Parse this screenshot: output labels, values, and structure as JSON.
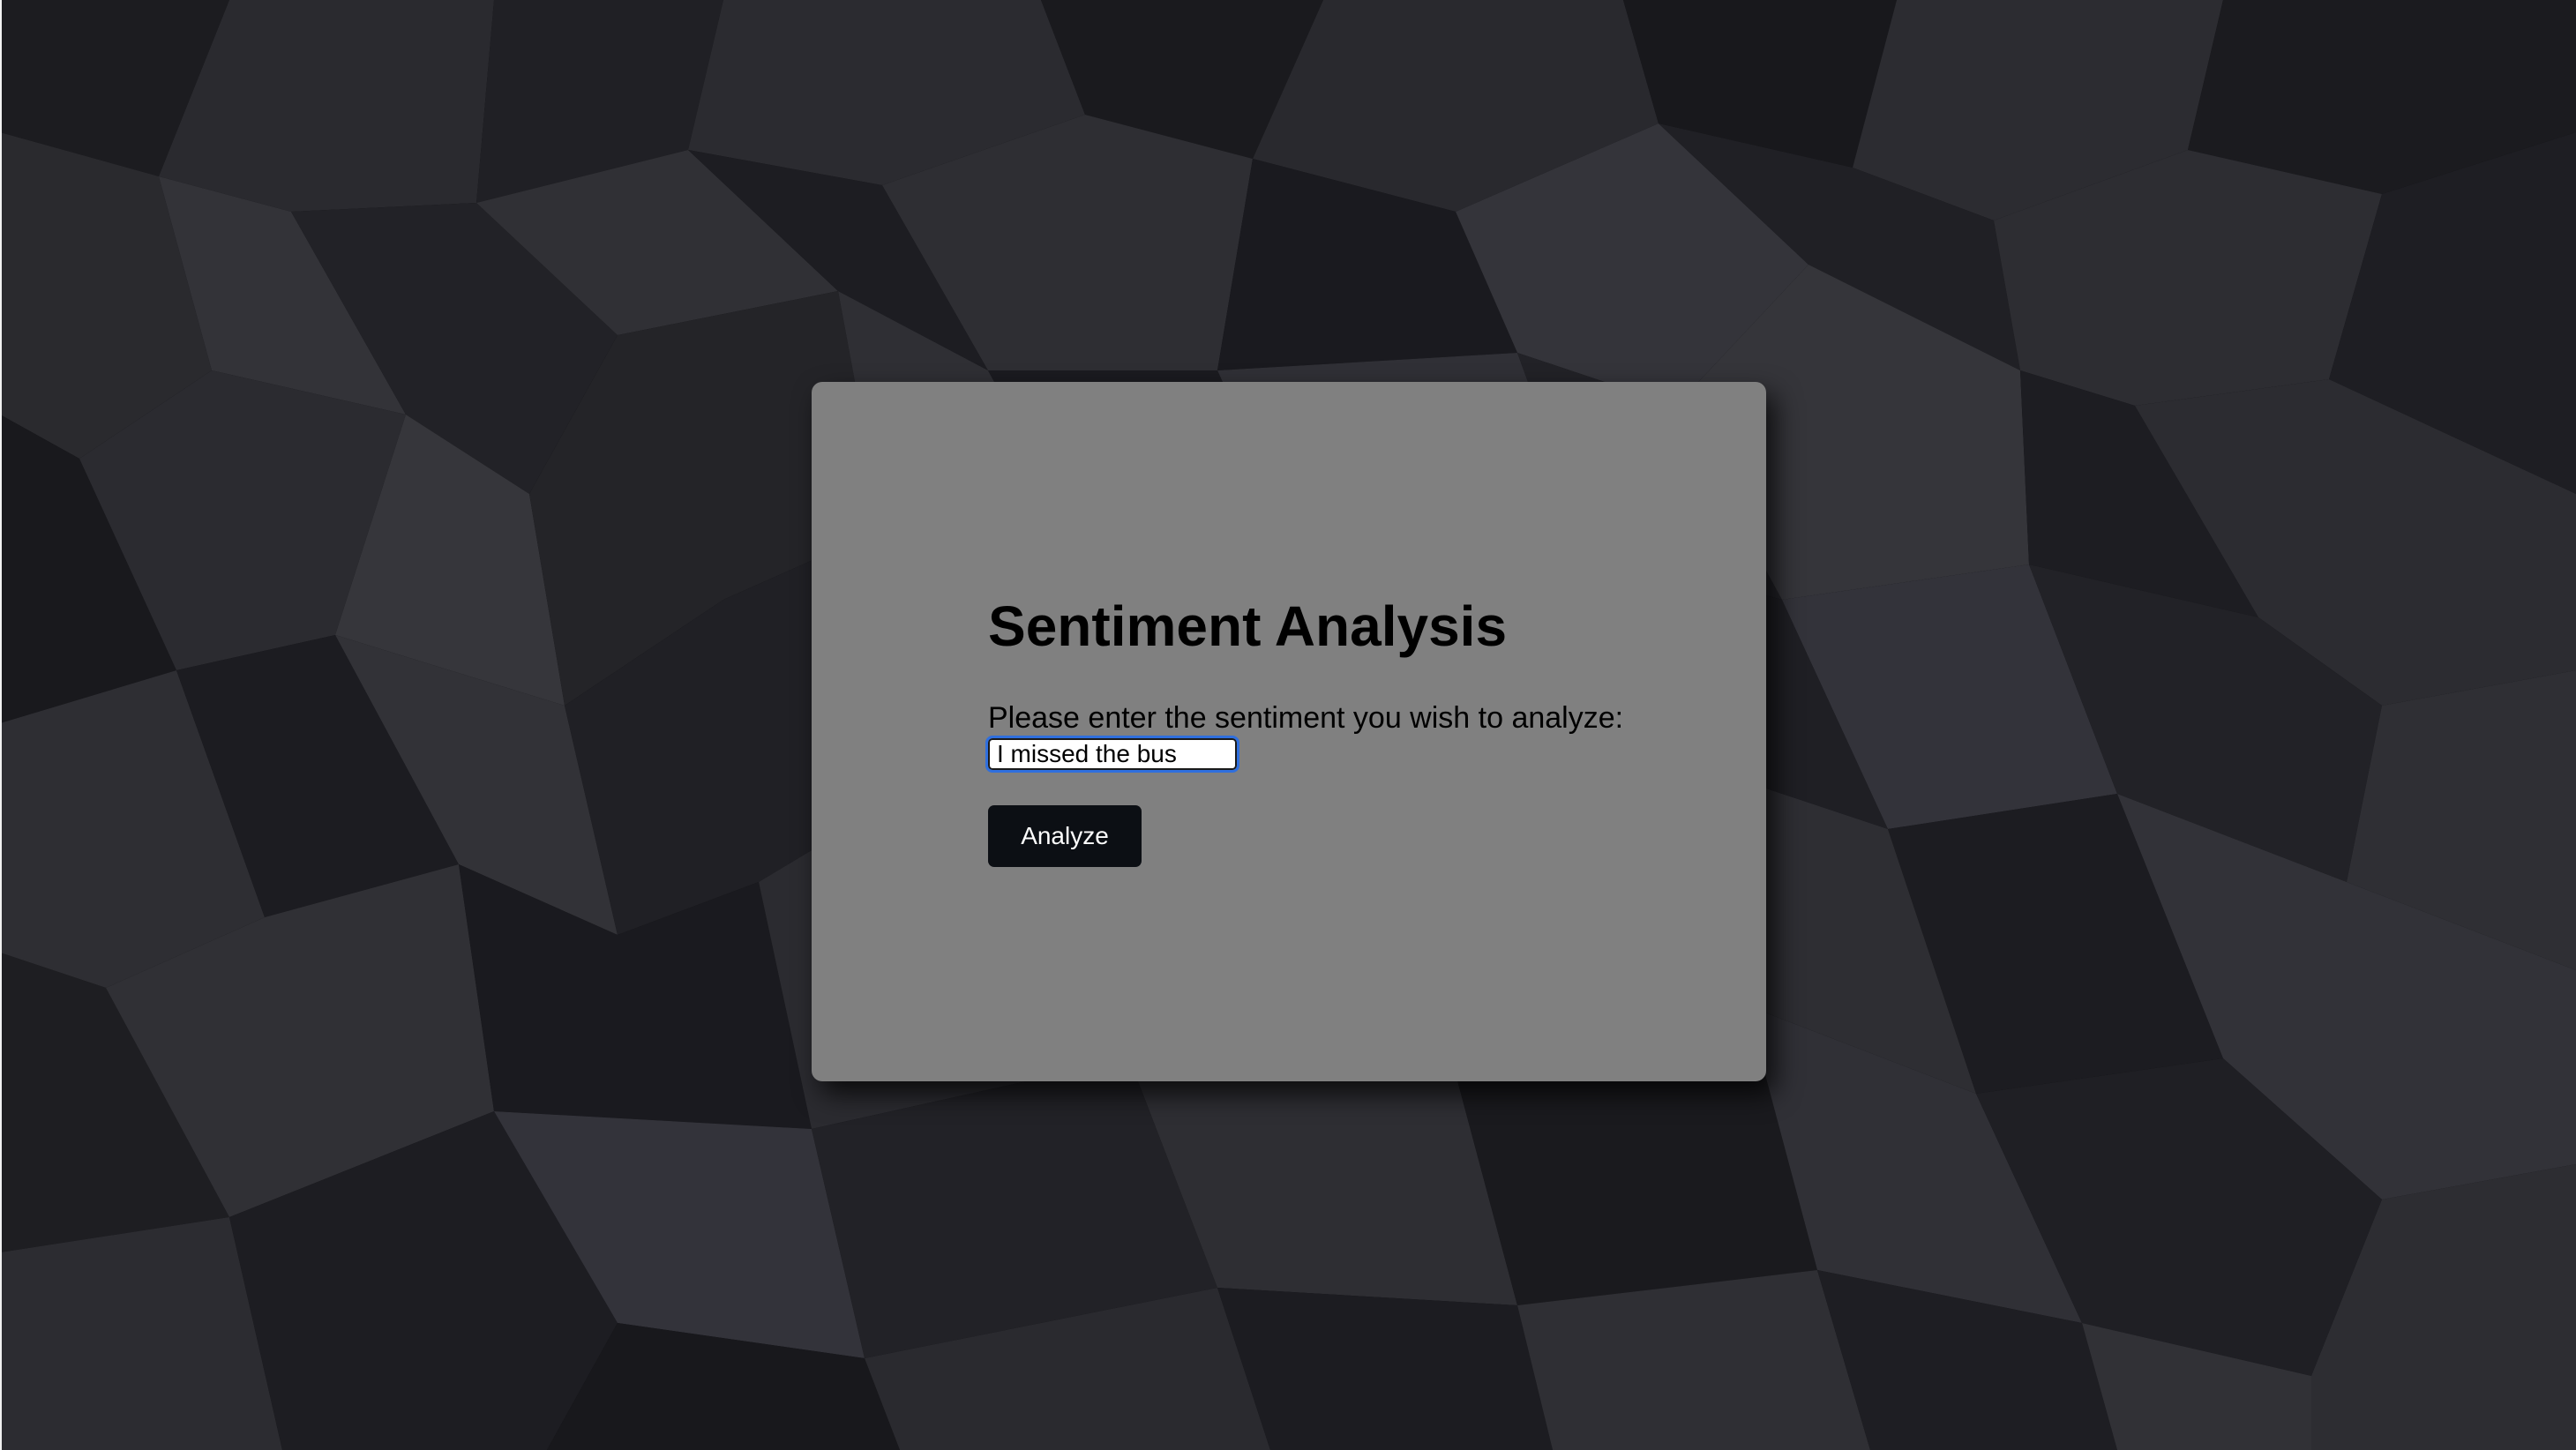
{
  "theme": {
    "page_background": "#0d0d10",
    "card_background": "#808080",
    "button_background": "#0c0f14",
    "button_text": "#ffffff",
    "focus_ring": "#2f6fde"
  },
  "card": {
    "title": "Sentiment Analysis",
    "prompt": "Please enter the sentiment you wish to analyze:",
    "input_value": "I missed the bus",
    "button_label": "Analyze"
  }
}
